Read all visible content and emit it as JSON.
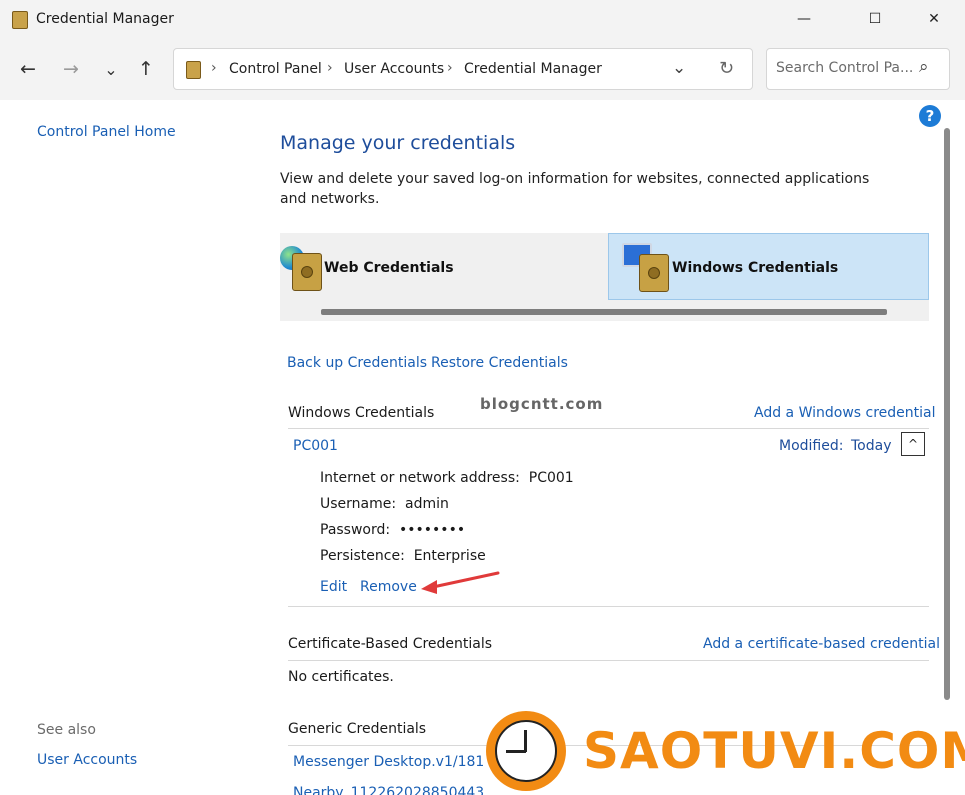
{
  "window": {
    "title": "Credential Manager",
    "minimize": "—",
    "maximize": "☐",
    "close": "✕"
  },
  "nav": {
    "back": "←",
    "forward": "→",
    "recent": "⌄",
    "up": "↑",
    "breadcrumb": [
      "Control Panel",
      "User Accounts",
      "Credential Manager"
    ],
    "breadcrumb_sep": "›",
    "dropdown": "⌄",
    "refresh": "↻",
    "search_placeholder": "Search Control Pa...",
    "search_icon": "⌕"
  },
  "sidebar": {
    "home": "Control Panel Home",
    "see_also": "See also",
    "user_accounts": "User Accounts"
  },
  "main": {
    "help": "?",
    "title": "Manage your credentials",
    "description": "View and delete your saved log-on information for websites, connected applications and networks.",
    "tabs": {
      "web": "Web Credentials",
      "windows": "Windows Credentials",
      "selected": "windows"
    },
    "backup": "Back up Credentials",
    "restore": "Restore Credentials",
    "windows_section": {
      "heading": "Windows Credentials",
      "add": "Add a Windows credential",
      "entry": {
        "name": "PC001",
        "modified_label": "Modified:",
        "modified_value": "Today",
        "expand_icon": "^",
        "address_label": "Internet or network address:",
        "address_value": "PC001",
        "username_label": "Username:",
        "username_value": "admin",
        "password_label": "Password:",
        "password_value": "••••••••",
        "persistence_label": "Persistence:",
        "persistence_value": "Enterprise",
        "edit": "Edit",
        "remove": "Remove"
      }
    },
    "certificate_section": {
      "heading": "Certificate-Based Credentials",
      "add": "Add a certificate-based credential",
      "empty": "No certificates."
    },
    "generic_section": {
      "heading": "Generic Credentials",
      "items": [
        "Messenger Desktop.v1/1814",
        "Nearby_11226202885044351"
      ]
    }
  },
  "overlay": {
    "watermark": "blogcntt.com",
    "logo": "SAOTUVI.COM",
    "arrow_color": "#e03a3a",
    "logo_color": "#f28b13"
  }
}
